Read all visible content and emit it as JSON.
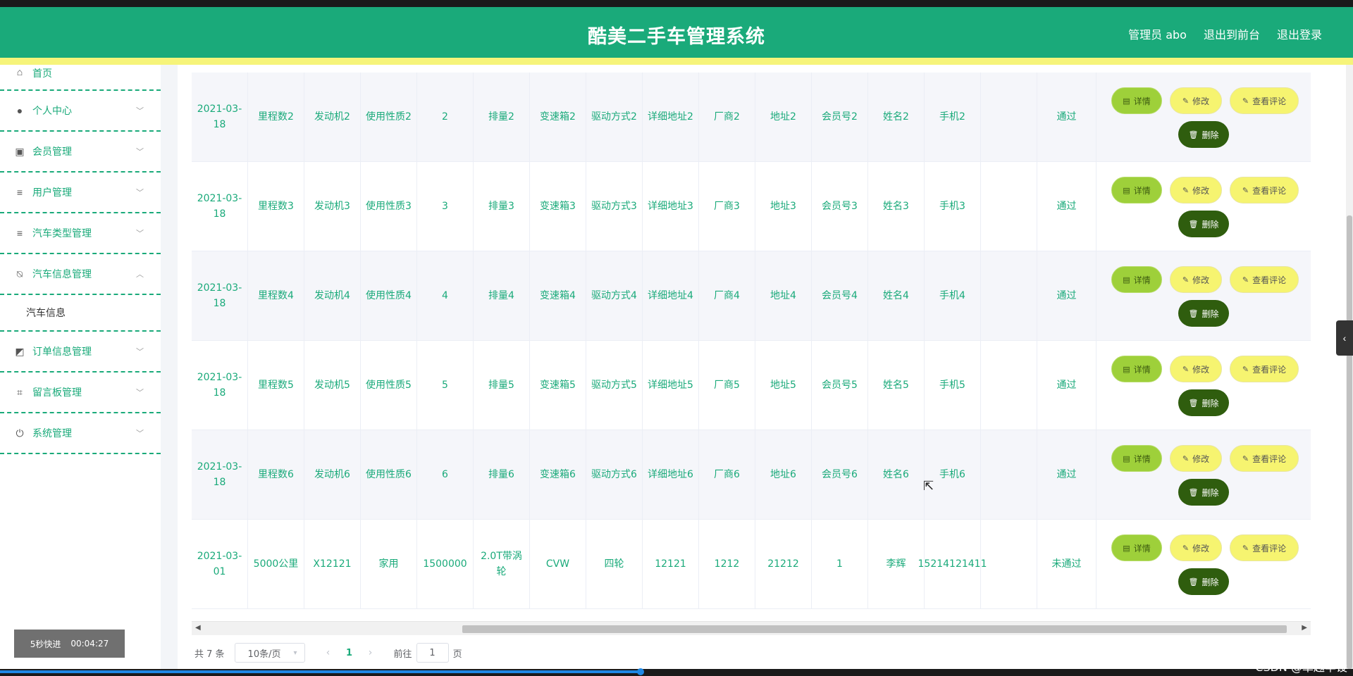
{
  "app": {
    "title": "酷美二手车管理系统",
    "links": [
      "管理员 abo",
      "退出到前台",
      "退出登录"
    ]
  },
  "sidebar": {
    "items": [
      {
        "label": "首页",
        "icon": "home-icon"
      },
      {
        "label": "个人中心",
        "icon": "user-icon"
      },
      {
        "label": "会员管理",
        "icon": "clipboard-icon"
      },
      {
        "label": "用户管理",
        "icon": "list-icon"
      },
      {
        "label": "汽车类型管理",
        "icon": "list-icon"
      },
      {
        "label": "汽车信息管理",
        "icon": "bell-off-icon"
      },
      {
        "label": "订单信息管理",
        "icon": "chart-icon"
      },
      {
        "label": "留言板管理",
        "icon": "crop-icon"
      },
      {
        "label": "系统管理",
        "icon": "power-icon"
      }
    ],
    "submenu": "汽车信息"
  },
  "table": {
    "rows": [
      {
        "date": "2021-03-18",
        "mileage": "里程数2",
        "engine": "发动机2",
        "usage": "使用性质2",
        "num": "2",
        "displacement": "排量2",
        "gearbox": "变速箱2",
        "drive": "驱动方式2",
        "address_detail": "详细地址2",
        "maker": "厂商2",
        "address": "地址2",
        "member": "会员号2",
        "name": "姓名2",
        "phone": "手机2",
        "extra": "",
        "status": "通过"
      },
      {
        "date": "2021-03-18",
        "mileage": "里程数3",
        "engine": "发动机3",
        "usage": "使用性质3",
        "num": "3",
        "displacement": "排量3",
        "gearbox": "变速箱3",
        "drive": "驱动方式3",
        "address_detail": "详细地址3",
        "maker": "厂商3",
        "address": "地址3",
        "member": "会员号3",
        "name": "姓名3",
        "phone": "手机3",
        "extra": "",
        "status": "通过"
      },
      {
        "date": "2021-03-18",
        "mileage": "里程数4",
        "engine": "发动机4",
        "usage": "使用性质4",
        "num": "4",
        "displacement": "排量4",
        "gearbox": "变速箱4",
        "drive": "驱动方式4",
        "address_detail": "详细地址4",
        "maker": "厂商4",
        "address": "地址4",
        "member": "会员号4",
        "name": "姓名4",
        "phone": "手机4",
        "extra": "",
        "status": "通过"
      },
      {
        "date": "2021-03-18",
        "mileage": "里程数5",
        "engine": "发动机5",
        "usage": "使用性质5",
        "num": "5",
        "displacement": "排量5",
        "gearbox": "变速箱5",
        "drive": "驱动方式5",
        "address_detail": "详细地址5",
        "maker": "厂商5",
        "address": "地址5",
        "member": "会员号5",
        "name": "姓名5",
        "phone": "手机5",
        "extra": "",
        "status": "通过"
      },
      {
        "date": "2021-03-18",
        "mileage": "里程数6",
        "engine": "发动机6",
        "usage": "使用性质6",
        "num": "6",
        "displacement": "排量6",
        "gearbox": "变速箱6",
        "drive": "驱动方式6",
        "address_detail": "详细地址6",
        "maker": "厂商6",
        "address": "地址6",
        "member": "会员号6",
        "name": "姓名6",
        "phone": "手机6",
        "extra": "",
        "status": "通过"
      },
      {
        "date": "2021-03-01",
        "mileage": "5000公里",
        "engine": "X12121",
        "usage": "家用",
        "num": "1500000",
        "displacement": "2.0T带涡轮",
        "gearbox": "CVW",
        "drive": "四轮",
        "address_detail": "12121",
        "maker": "1212",
        "address": "21212",
        "member": "1",
        "name": "李辉",
        "phone": "15214121411",
        "extra": "",
        "status": "未通过"
      }
    ],
    "actions": {
      "detail": "详情",
      "edit": "修改",
      "comment": "查看评论",
      "delete": "删除"
    }
  },
  "pager": {
    "total": "共 7 条",
    "page_size": "10条/页",
    "current": "1",
    "goto_label": "前往",
    "goto_value": "1",
    "page_suffix": "页"
  },
  "overlay": {
    "badge_label": "5秒快进",
    "badge_time": "00:04:27",
    "watermark": "CSDN @卓越毕设"
  },
  "colors": {
    "primary": "#1aaa7a",
    "strip": "#f6f47a",
    "detail": "#9ed03a",
    "edit": "#f6f470",
    "delete": "#2f5d0e"
  }
}
